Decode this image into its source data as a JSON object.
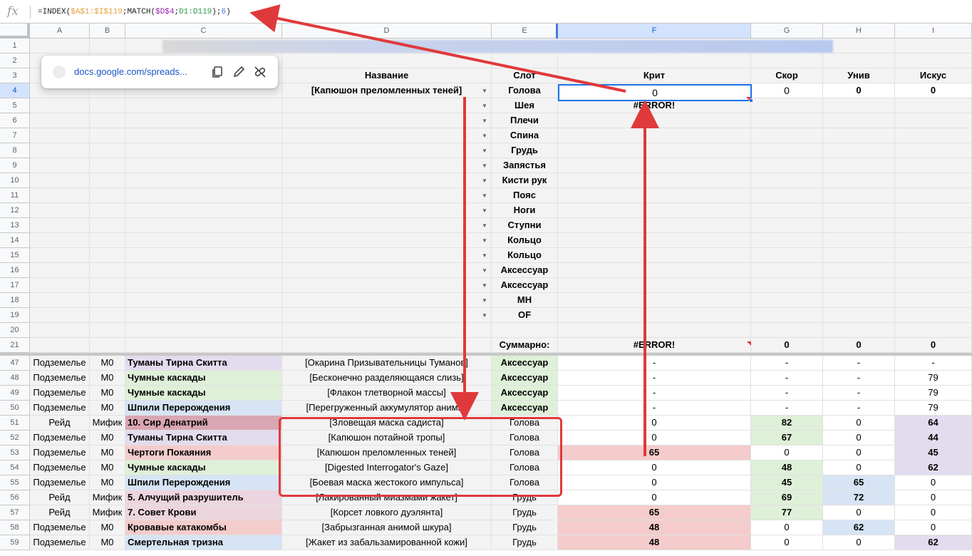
{
  "formula_bar": {
    "fx_label": "fx",
    "parts": [
      {
        "text": "=INDEX(",
        "cls": ""
      },
      {
        "text": "$A$1:$I$119",
        "cls": "t-orange"
      },
      {
        "text": ";MATCH(",
        "cls": ""
      },
      {
        "text": "$D$4",
        "cls": "t-purple"
      },
      {
        "text": ";",
        "cls": ""
      },
      {
        "text": "D1:D119",
        "cls": "t-green"
      },
      {
        "text": ");",
        "cls": ""
      },
      {
        "text": "6",
        "cls": "t-blue"
      },
      {
        "text": ")",
        "cls": ""
      }
    ]
  },
  "columns": [
    "A",
    "B",
    "C",
    "D",
    "E",
    "F",
    "G",
    "H",
    "I"
  ],
  "selected_column": "F",
  "link_popup": {
    "url": "docs.google.com/spreads...",
    "copy_icon": "copy-icon",
    "edit_icon": "edit-pencil-icon",
    "unlink_icon": "unlink-icon"
  },
  "top_rows": [
    {
      "n": "1"
    },
    {
      "n": "2"
    },
    {
      "n": "3",
      "d": "Название",
      "e": "Слот",
      "f": "Крит",
      "g": "Скор",
      "h": "Унив",
      "i": "Искус"
    },
    {
      "n": "4",
      "d": "[Капюшон преломленных теней]",
      "e": "Голова",
      "f": "0",
      "g": "0",
      "h": "0",
      "i": "0",
      "dd": true
    },
    {
      "n": "5",
      "e": "Шея",
      "f": "#ERROR!",
      "dd": true
    },
    {
      "n": "6",
      "e": "Плечи",
      "dd": true
    },
    {
      "n": "7",
      "e": "Спина",
      "dd": true
    },
    {
      "n": "8",
      "e": "Грудь",
      "dd": true
    },
    {
      "n": "9",
      "e": "Запястья",
      "dd": true
    },
    {
      "n": "10",
      "e": "Кисти рук",
      "dd": true
    },
    {
      "n": "11",
      "e": "Пояс",
      "dd": true
    },
    {
      "n": "12",
      "e": "Ноги",
      "dd": true
    },
    {
      "n": "13",
      "e": "Ступни",
      "dd": true
    },
    {
      "n": "14",
      "e": "Кольцо",
      "dd": true
    },
    {
      "n": "15",
      "e": "Кольцо",
      "dd": true
    },
    {
      "n": "16",
      "e": "Аксессуар",
      "dd": true
    },
    {
      "n": "17",
      "e": "Аксессуар",
      "dd": true
    },
    {
      "n": "18",
      "e": "МН",
      "dd": true
    },
    {
      "n": "19",
      "e": "OF",
      "dd": true
    },
    {
      "n": "20"
    },
    {
      "n": "21",
      "e": "Суммарно:",
      "f": "#ERROR!",
      "g": "0",
      "h": "0",
      "i": "0"
    }
  ],
  "data_rows": [
    {
      "n": "47",
      "a": "Подземелье",
      "b": "М0",
      "c": "Туманы Тирна Скитта",
      "c_color": "#e3dcef",
      "d": "[Окарина Призывательницы Туманов]",
      "e": "Аксессуар",
      "e_color": "#dff0d8",
      "f": "-",
      "g": "-",
      "h": "-",
      "i": "-"
    },
    {
      "n": "48",
      "a": "Подземелье",
      "b": "М0",
      "c": "Чумные каскады",
      "c_color": "#dff0d8",
      "d": "[Бесконечно разделяющаяся слизь]",
      "e": "Аксессуар",
      "e_color": "#dff0d8",
      "f": "-",
      "g": "-",
      "h": "-",
      "i": "79"
    },
    {
      "n": "49",
      "a": "Подземелье",
      "b": "М0",
      "c": "Чумные каскады",
      "c_color": "#dff0d8",
      "d": "[Флакон тлетворной массы]",
      "e": "Аксессуар",
      "e_color": "#dff0d8",
      "f": "-",
      "g": "-",
      "h": "-",
      "i": "79"
    },
    {
      "n": "50",
      "a": "Подземелье",
      "b": "М0",
      "c": "Шпили Перерождения",
      "c_color": "#d6e4f5",
      "d": "[Перегруженный аккумулятор анимы]",
      "e": "Аксессуар",
      "e_color": "#dff0d8",
      "f": "-",
      "g": "-",
      "h": "-",
      "i": "79"
    },
    {
      "n": "51",
      "a": "Рейд",
      "b": "Мифик",
      "c": "10. Сир Денатрий",
      "c_color": "#d9a6b3",
      "d": "[Зловещая маска садиста]",
      "e": "Голова",
      "f": "0",
      "g": "82",
      "g_color": "#dff0d8",
      "h": "0",
      "i": "64",
      "i_color": "#e3dcef"
    },
    {
      "n": "52",
      "a": "Подземелье",
      "b": "М0",
      "c": "Туманы Тирна Скитта",
      "c_color": "#e3dcef",
      "d": "[Капюшон потайной тропы]",
      "e": "Голова",
      "f": "0",
      "g": "67",
      "g_color": "#dff0d8",
      "h": "0",
      "i": "44",
      "i_color": "#e3dcef"
    },
    {
      "n": "53",
      "a": "Подземелье",
      "b": "М0",
      "c": "Чертоги Покаяния",
      "c_color": "#f4cccc",
      "d": "[Капюшон преломленных теней]",
      "e": "Голова",
      "f": "65",
      "f_color": "#f4cccc",
      "g": "0",
      "h": "0",
      "i": "45",
      "i_color": "#e3dcef"
    },
    {
      "n": "54",
      "a": "Подземелье",
      "b": "М0",
      "c": "Чумные каскады",
      "c_color": "#dff0d8",
      "d": "[Digested Interrogator's Gaze]",
      "e": "Голова",
      "f": "0",
      "g": "48",
      "g_color": "#dff0d8",
      "h": "0",
      "i": "62",
      "i_color": "#e3dcef"
    },
    {
      "n": "55",
      "a": "Подземелье",
      "b": "М0",
      "c": "Шпили Перерождения",
      "c_color": "#d6e4f5",
      "d": "[Боевая маска жестокого импульса]",
      "e": "Голова",
      "f": "0",
      "g": "45",
      "g_color": "#dff0d8",
      "h": "65",
      "h_color": "#d6e4f5",
      "i": "0"
    },
    {
      "n": "56",
      "a": "Рейд",
      "b": "Мифик",
      "c": "5. Алчущий разрушитель",
      "c_color": "#ecd5de",
      "d": "[Лакированный миазмами жакет]",
      "e": "Грудь",
      "f": "0",
      "g": "69",
      "g_color": "#dff0d8",
      "h": "72",
      "h_color": "#d6e4f5",
      "i": "0"
    },
    {
      "n": "57",
      "a": "Рейд",
      "b": "Мифик",
      "c": "7. Совет Крови",
      "c_color": "#ecd5de",
      "d": "[Корсет ловкого дуэлянта]",
      "e": "Грудь",
      "f": "65",
      "f_color": "#f4cccc",
      "g": "77",
      "g_color": "#dff0d8",
      "h": "0",
      "i": "0"
    },
    {
      "n": "58",
      "a": "Подземелье",
      "b": "М0",
      "c": "Кровавые катакомбы",
      "c_color": "#f4cccc",
      "d": "[Забрызганная анимой шкура]",
      "e": "Грудь",
      "f": "48",
      "f_color": "#f4cccc",
      "g": "0",
      "h": "62",
      "h_color": "#d6e4f5",
      "i": "0"
    },
    {
      "n": "59",
      "a": "Подземелье",
      "b": "М0",
      "c": "Смертельная тризна",
      "c_color": "#d6e4f5",
      "d": "[Жакет из забальзамированной кожи]",
      "e": "Грудь",
      "f": "48",
      "f_color": "#f4cccc",
      "g": "0",
      "h": "0",
      "i": "62",
      "i_color": "#e3dcef"
    }
  ]
}
